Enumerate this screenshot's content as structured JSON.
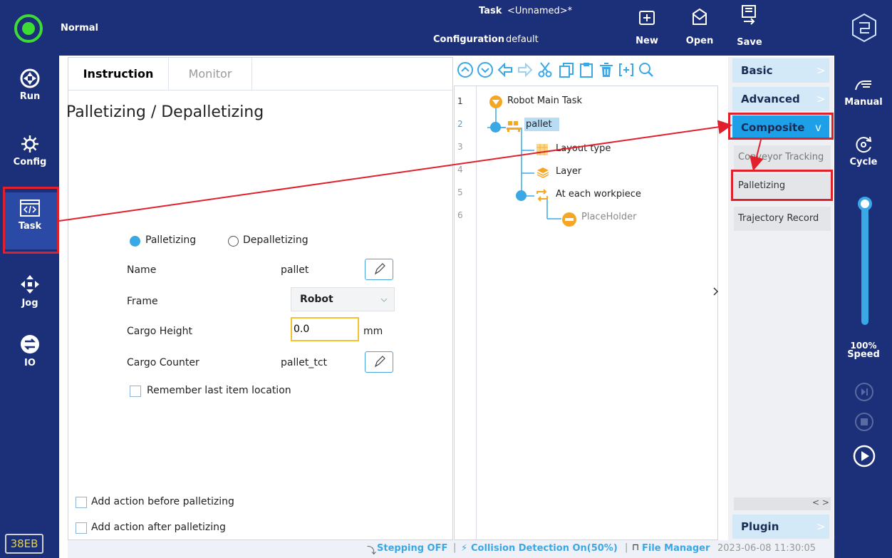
{
  "topbar": {
    "mode": "Normal",
    "task_label": "Task",
    "task_value": "<Unnamed>*",
    "config_label": "Configuration",
    "config_value": "default",
    "new_label": "New",
    "open_label": "Open",
    "save_label": "Save"
  },
  "leftnav": {
    "items": [
      {
        "label": "Run",
        "icon": "run-icon"
      },
      {
        "label": "Config",
        "icon": "gear-icon"
      },
      {
        "label": "Task",
        "icon": "code-window-icon"
      },
      {
        "label": "Jog",
        "icon": "move-arrows-icon"
      },
      {
        "label": "IO",
        "icon": "io-arrows-icon"
      }
    ],
    "badge": "38EB"
  },
  "rightnav": {
    "manual_label": "Manual",
    "cycle_label": "Cycle",
    "speed_value": "100%",
    "speed_label": "Speed",
    "speed_fraction": 1.0
  },
  "instruction": {
    "tabs": [
      "Instruction",
      "Monitor"
    ],
    "title": "Palletizing / Depalletizing",
    "mode_options": [
      "Palletizing",
      "Depalletizing"
    ],
    "mode_selected": "Palletizing",
    "name_label": "Name",
    "name_value": "pallet",
    "frame_label": "Frame",
    "frame_value": "Robot",
    "cargo_height_label": "Cargo Height",
    "cargo_height_value": "0.0",
    "cargo_height_unit": "mm",
    "cargo_counter_label": "Cargo Counter",
    "cargo_counter_value": "pallet_tct",
    "remember_label": "Remember last item location",
    "action_before_label": "Add action before palletizing",
    "action_after_label": "Add action after palletizing"
  },
  "tree": {
    "line_numbers": [
      "1",
      "2",
      "3",
      "4",
      "5",
      "6"
    ],
    "nodes": [
      "Robot Main Task",
      "pallet",
      "Layout type",
      "Layer",
      "At each workpiece",
      "PlaceHolder"
    ]
  },
  "categories": {
    "basic": "Basic",
    "advanced": "Advanced",
    "composite": "Composite",
    "items": [
      "Conveyor Tracking",
      "Palletizing",
      "Trajectory Record"
    ],
    "plugin": "Plugin"
  },
  "statusbar": {
    "stepping": "Stepping OFF",
    "collision": "Collision Detection On(50%)",
    "file_manager": "File Manager",
    "datetime": "2023-06-08 11:30:05"
  },
  "colors": {
    "nav_bg": "#1c2f79",
    "accent": "#3ba8e6",
    "highlight": "#e0202a"
  }
}
